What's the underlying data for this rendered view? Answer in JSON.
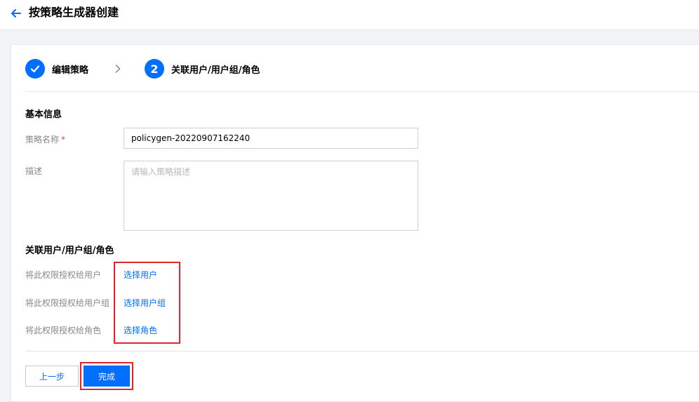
{
  "header": {
    "title": "按策略生成器创建",
    "back_icon": "arrow-left-icon"
  },
  "steps": [
    {
      "label": "编辑策略",
      "state": "done",
      "icon": "check-icon"
    },
    {
      "number": "2",
      "label": "关联用户/用户组/角色",
      "state": "active"
    }
  ],
  "basic_info": {
    "title": "基本信息",
    "name_label": "策略名称",
    "required_mark": "*",
    "name_value": "policygen-20220907162240",
    "desc_label": "描述",
    "desc_placeholder": "请输入策略描述"
  },
  "association": {
    "title": "关联用户/用户组/角色",
    "rows": [
      {
        "label": "将此权限授权给用户",
        "link": "选择用户"
      },
      {
        "label": "将此权限授权给用户组",
        "link": "选择用户组"
      },
      {
        "label": "将此权限授权给角色",
        "link": "选择角色"
      }
    ]
  },
  "footer": {
    "prev_label": "上一步",
    "done_label": "完成"
  },
  "colors": {
    "accent": "#006eff",
    "highlight": "#e0262a"
  }
}
